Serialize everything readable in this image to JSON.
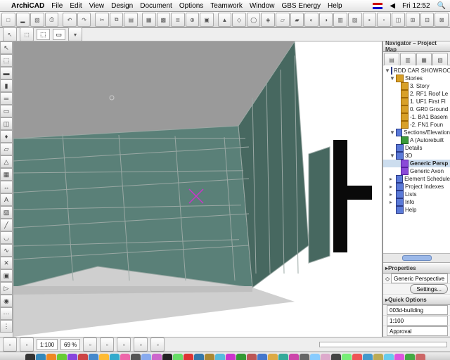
{
  "menubar": {
    "apple": "",
    "app": "ArchiCAD",
    "items": [
      "File",
      "Edit",
      "View",
      "Design",
      "Document",
      "Options",
      "Teamwork",
      "Window",
      "GBS Energy",
      "Help"
    ],
    "clock": "Fri 12:52"
  },
  "shelf": {
    "btn1": "⬚",
    "btn2": "▭"
  },
  "navigator": {
    "title": "Navigator – Project Map",
    "root": "RDD CAR SHOWROOM",
    "stories_label": "Stories",
    "stories": [
      {
        "label": "3. Story"
      },
      {
        "label": "2. RF1 Roof Le"
      },
      {
        "label": "1. UF1 First Fl"
      },
      {
        "label": "0. GR0 Ground"
      },
      {
        "label": "-1. BA1 Basem"
      },
      {
        "label": "-2. FN1 Foun"
      }
    ],
    "sections_label": "Sections/Elevation",
    "section_item": "A (Autorebuilt",
    "details_label": "Details",
    "three_d_label": "3D",
    "three_d_items": [
      {
        "label": "Generic Persp",
        "selected": true
      },
      {
        "label": "Generic Axon",
        "selected": false
      }
    ],
    "schedule_label": "Element Schedule",
    "indexes_label": "Project Indexes",
    "lists_label": "Lists",
    "info_label": "Info",
    "help_label": "Help"
  },
  "properties": {
    "title": "Properties",
    "view": "Generic Perspective",
    "settings_btn": "Settings...",
    "quick_title": "Quick Options",
    "layer": "003d-building",
    "scale": "1:100",
    "approval": "Approval"
  },
  "status": {
    "scale": "1:100",
    "zoom": "69 %"
  },
  "colors": {
    "wall": "#5a8078",
    "wall_dark": "#476860",
    "grout": "#9aa8a4",
    "floor": "#cfcfcf",
    "sky": "#9a9a9a",
    "black": "#0a0a0a",
    "cursor": "#cc33cc"
  },
  "dock_colors": [
    "#333",
    "#38b",
    "#e82",
    "#6c3",
    "#84d",
    "#c44",
    "#48c",
    "#fb3",
    "#3ac",
    "#e6a",
    "#555",
    "#8ae",
    "#c6c",
    "#222",
    "#6d6",
    "#d33",
    "#37a",
    "#a83",
    "#5bd",
    "#c3c",
    "#393",
    "#b55",
    "#47c",
    "#da4",
    "#3a9",
    "#c4a",
    "#666",
    "#8cf",
    "#dac",
    "#444",
    "#7e7",
    "#e55",
    "#49c",
    "#ba5",
    "#6ce",
    "#d5d",
    "#4a4",
    "#c66"
  ]
}
